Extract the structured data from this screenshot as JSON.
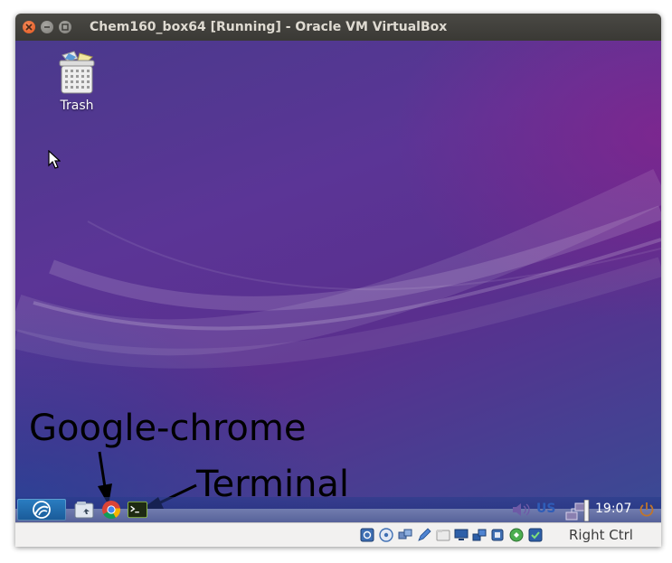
{
  "window": {
    "title": "Chem160_box64 [Running] - Oracle VM VirtualBox",
    "title_color": "#dfdbd2",
    "close_color": "#e2561d"
  },
  "desktop": {
    "icons": [
      {
        "label": "Trash",
        "icon": "trash-icon"
      }
    ]
  },
  "annotations": {
    "chrome_label": "Google-chrome",
    "terminal_label": "Terminal"
  },
  "taskbar": {
    "start_icon": "lubuntu-logo-icon",
    "launchers": [
      {
        "name": "file-manager",
        "icon": "folder-icon"
      },
      {
        "name": "google-chrome",
        "icon": "chrome-icon"
      },
      {
        "name": "terminal",
        "icon": "terminal-icon"
      }
    ],
    "tray": {
      "volume_icon": "speaker-icon",
      "keyboard_layout": "US",
      "network_icon": "network-icon",
      "clock": "19:07",
      "power_icon": "power-icon"
    }
  },
  "statusbar": {
    "icons": [
      "hard-disk-icon",
      "optical-drive-icon",
      "usb-icon",
      "pencil-icon",
      "shared-folder-icon",
      "display-icon",
      "network-adapter-icon",
      "cpu-icon",
      "mouse-integration-icon",
      "capture-icon"
    ],
    "host_key": "Right Ctrl"
  }
}
